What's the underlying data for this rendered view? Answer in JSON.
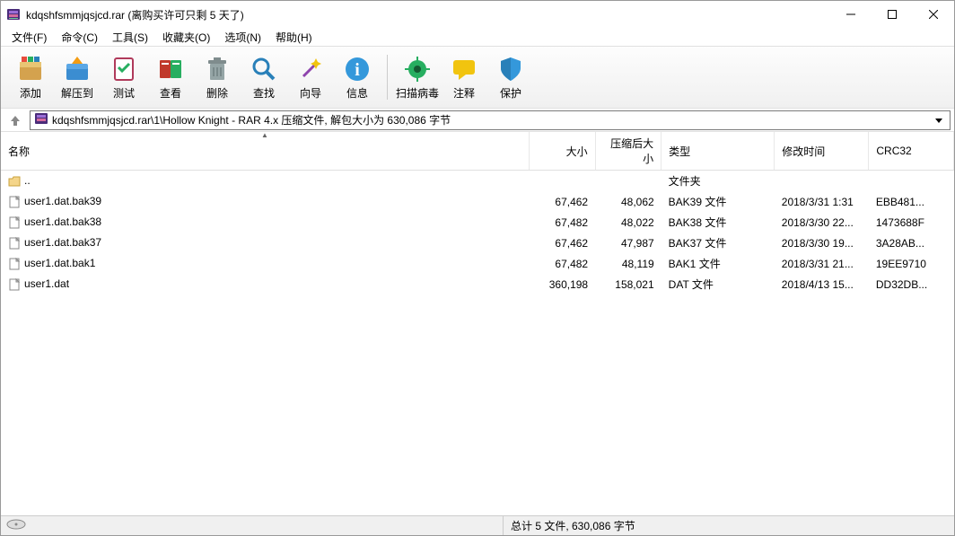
{
  "window": {
    "title": "kdqshfsmmjqsjcd.rar (离购买许可只剩 5 天了)"
  },
  "menu": {
    "file": "文件(F)",
    "commands": "命令(C)",
    "tools": "工具(S)",
    "favorites": "收藏夹(O)",
    "options": "选项(N)",
    "help": "帮助(H)"
  },
  "toolbar": {
    "add": "添加",
    "extract": "解压到",
    "test": "测试",
    "view": "查看",
    "delete": "删除",
    "find": "查找",
    "wizard": "向导",
    "info": "信息",
    "virus": "扫描病毒",
    "comment": "注释",
    "protect": "保护"
  },
  "path": "kdqshfsmmjqsjcd.rar\\1\\Hollow Knight - RAR 4.x 压缩文件, 解包大小为 630,086 字节",
  "columns": {
    "name": "名称",
    "size": "大小",
    "packed": "压缩后大小",
    "type": "类型",
    "modified": "修改时间",
    "crc": "CRC32"
  },
  "parent": {
    "name": "..",
    "type": "文件夹"
  },
  "files": [
    {
      "name": "user1.dat.bak39",
      "size": "67,462",
      "packed": "48,062",
      "type": "BAK39 文件",
      "modified": "2018/3/31 1:31",
      "crc": "EBB481..."
    },
    {
      "name": "user1.dat.bak38",
      "size": "67,482",
      "packed": "48,022",
      "type": "BAK38 文件",
      "modified": "2018/3/30 22...",
      "crc": "1473688F"
    },
    {
      "name": "user1.dat.bak37",
      "size": "67,462",
      "packed": "47,987",
      "type": "BAK37 文件",
      "modified": "2018/3/30 19...",
      "crc": "3A28AB..."
    },
    {
      "name": "user1.dat.bak1",
      "size": "67,482",
      "packed": "48,119",
      "type": "BAK1 文件",
      "modified": "2018/3/31 21...",
      "crc": "19EE9710"
    },
    {
      "name": "user1.dat",
      "size": "360,198",
      "packed": "158,021",
      "type": "DAT 文件",
      "modified": "2018/4/13 15...",
      "crc": "DD32DB..."
    }
  ],
  "status": "总计 5 文件, 630,086 字节"
}
